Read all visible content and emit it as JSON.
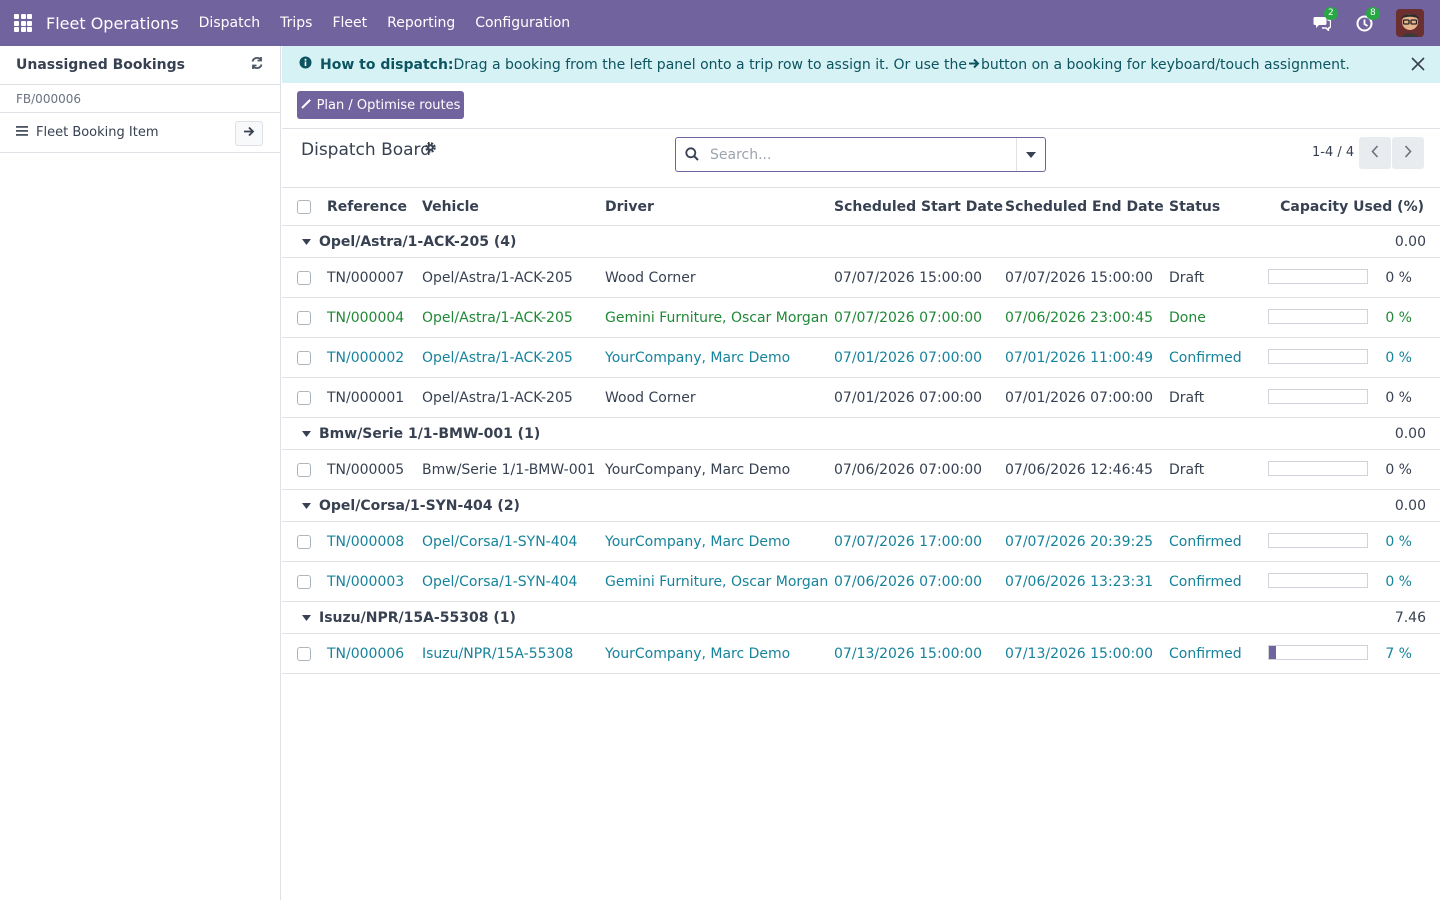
{
  "navbar": {
    "app_name": "Fleet Operations",
    "menu": [
      "Dispatch",
      "Trips",
      "Fleet",
      "Reporting",
      "Configuration"
    ],
    "messages_badge": "2",
    "activities_badge": "8",
    "icons": [
      "apps-grid-icon",
      "chat-icon",
      "clock-icon",
      "avatar"
    ]
  },
  "left_panel": {
    "title": "Unassigned Bookings",
    "booking_ref": "FB/000006",
    "item_label": "Fleet Booking Item"
  },
  "banner": {
    "title": "How to dispatch:",
    "text_before": "Drag a booking from the left panel onto a trip row to assign it. Or use the",
    "text_after": "button on a booking for keyboard/touch assignment."
  },
  "action": {
    "plan_label": "Plan / Optimise routes"
  },
  "control": {
    "title": "Dispatch Board",
    "search_placeholder": "Search...",
    "pager": "1-4 / 4"
  },
  "table": {
    "headers": {
      "reference": "Reference",
      "vehicle": "Vehicle",
      "driver": "Driver",
      "start": "Scheduled Start Date",
      "end": "Scheduled End Date",
      "status": "Status",
      "capacity": "Capacity Used (%)"
    },
    "groups": [
      {
        "title": "Opel/Astra/1-ACK-205 (4)",
        "total": "0.00",
        "rows": [
          {
            "ref": "TN/000007",
            "vehicle": "Opel/Astra/1-ACK-205",
            "driver": "Wood Corner",
            "start": "07/07/2026 15:00:00",
            "end": "07/07/2026 15:00:00",
            "status": "Draft",
            "capacity": 0,
            "capacity_label": "0 %",
            "tone": "draft"
          },
          {
            "ref": "TN/000004",
            "vehicle": "Opel/Astra/1-ACK-205",
            "driver": "Gemini Furniture, Oscar Morgan",
            "start": "07/07/2026 07:00:00",
            "end": "07/06/2026 23:00:45",
            "status": "Done",
            "capacity": 0,
            "capacity_label": "0 %",
            "tone": "done"
          },
          {
            "ref": "TN/000002",
            "vehicle": "Opel/Astra/1-ACK-205",
            "driver": "YourCompany, Marc Demo",
            "start": "07/01/2026 07:00:00",
            "end": "07/01/2026 11:00:49",
            "status": "Confirmed",
            "capacity": 0,
            "capacity_label": "0 %",
            "tone": "confirmed"
          },
          {
            "ref": "TN/000001",
            "vehicle": "Opel/Astra/1-ACK-205",
            "driver": "Wood Corner",
            "start": "07/01/2026 07:00:00",
            "end": "07/01/2026 07:00:00",
            "status": "Draft",
            "capacity": 0,
            "capacity_label": "0 %",
            "tone": "draft"
          }
        ]
      },
      {
        "title": "Bmw/Serie 1/1-BMW-001 (1)",
        "total": "0.00",
        "rows": [
          {
            "ref": "TN/000005",
            "vehicle": "Bmw/Serie 1/1-BMW-001",
            "driver": "YourCompany, Marc Demo",
            "start": "07/06/2026 07:00:00",
            "end": "07/06/2026 12:46:45",
            "status": "Draft",
            "capacity": 0,
            "capacity_label": "0 %",
            "tone": "draft"
          }
        ]
      },
      {
        "title": "Opel/Corsa/1-SYN-404 (2)",
        "total": "0.00",
        "rows": [
          {
            "ref": "TN/000008",
            "vehicle": "Opel/Corsa/1-SYN-404",
            "driver": "YourCompany, Marc Demo",
            "start": "07/07/2026 17:00:00",
            "end": "07/07/2026 20:39:25",
            "status": "Confirmed",
            "capacity": 0,
            "capacity_label": "0 %",
            "tone": "confirmed"
          },
          {
            "ref": "TN/000003",
            "vehicle": "Opel/Corsa/1-SYN-404",
            "driver": "Gemini Furniture, Oscar Morgan",
            "start": "07/06/2026 07:00:00",
            "end": "07/06/2026 13:23:31",
            "status": "Confirmed",
            "capacity": 0,
            "capacity_label": "0 %",
            "tone": "confirmed"
          }
        ]
      },
      {
        "title": "Isuzu/NPR/15A-55308 (1)",
        "total": "7.46",
        "rows": [
          {
            "ref": "TN/000006",
            "vehicle": "Isuzu/NPR/15A-55308",
            "driver": "YourCompany, Marc Demo",
            "start": "07/13/2026 15:00:00",
            "end": "07/13/2026 15:00:00",
            "status": "Confirmed",
            "capacity": 7,
            "capacity_label": "7 %",
            "tone": "confirmed"
          }
        ]
      }
    ]
  },
  "colors": {
    "brand": "#71639e",
    "banner_bg": "#d7f2f5",
    "done": "#218838",
    "confirmed": "#17839b"
  }
}
